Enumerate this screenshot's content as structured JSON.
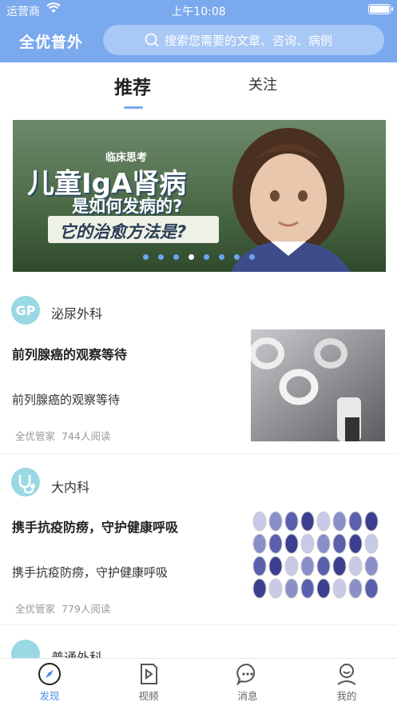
{
  "status_bar": {
    "carrier": "运营商",
    "time": "上午10:08"
  },
  "header": {
    "app_title": "全优普外",
    "search_placeholder": "搜索您需要的文章、咨询、病例"
  },
  "tabs": [
    {
      "label": "推荐",
      "active": true
    },
    {
      "label": "关注",
      "active": false
    }
  ],
  "banner": {
    "small_text": "临床思考",
    "big_text": "儿童IgA肾病",
    "mid_text": "是如何发病的?",
    "bar_text": "它的治愈方法是?",
    "dot_count": 8,
    "active_dot": 4
  },
  "articles": [
    {
      "department": "泌尿外科",
      "title": "前列腺癌的观察等待",
      "summary": "前列腺癌的观察等待",
      "author": "全优管家",
      "reads": "744人阅读"
    },
    {
      "department": "大内科",
      "title": "携手抗疫防痨，守护健康呼吸",
      "summary": "携手抗疫防痨，守护健康呼吸",
      "author": "全优管家",
      "reads": "779人阅读"
    },
    {
      "department": "普通外科"
    }
  ],
  "bottom_nav": [
    {
      "label": "发现",
      "icon": "compass-icon",
      "active": true
    },
    {
      "label": "视频",
      "icon": "video-icon",
      "active": false
    },
    {
      "label": "消息",
      "icon": "message-icon",
      "active": false
    },
    {
      "label": "我的",
      "icon": "profile-icon",
      "active": false
    }
  ],
  "colors": {
    "primary": "#7aa9ee",
    "active_nav": "#4d8de8",
    "dept_icon": "#9ad8e3"
  }
}
